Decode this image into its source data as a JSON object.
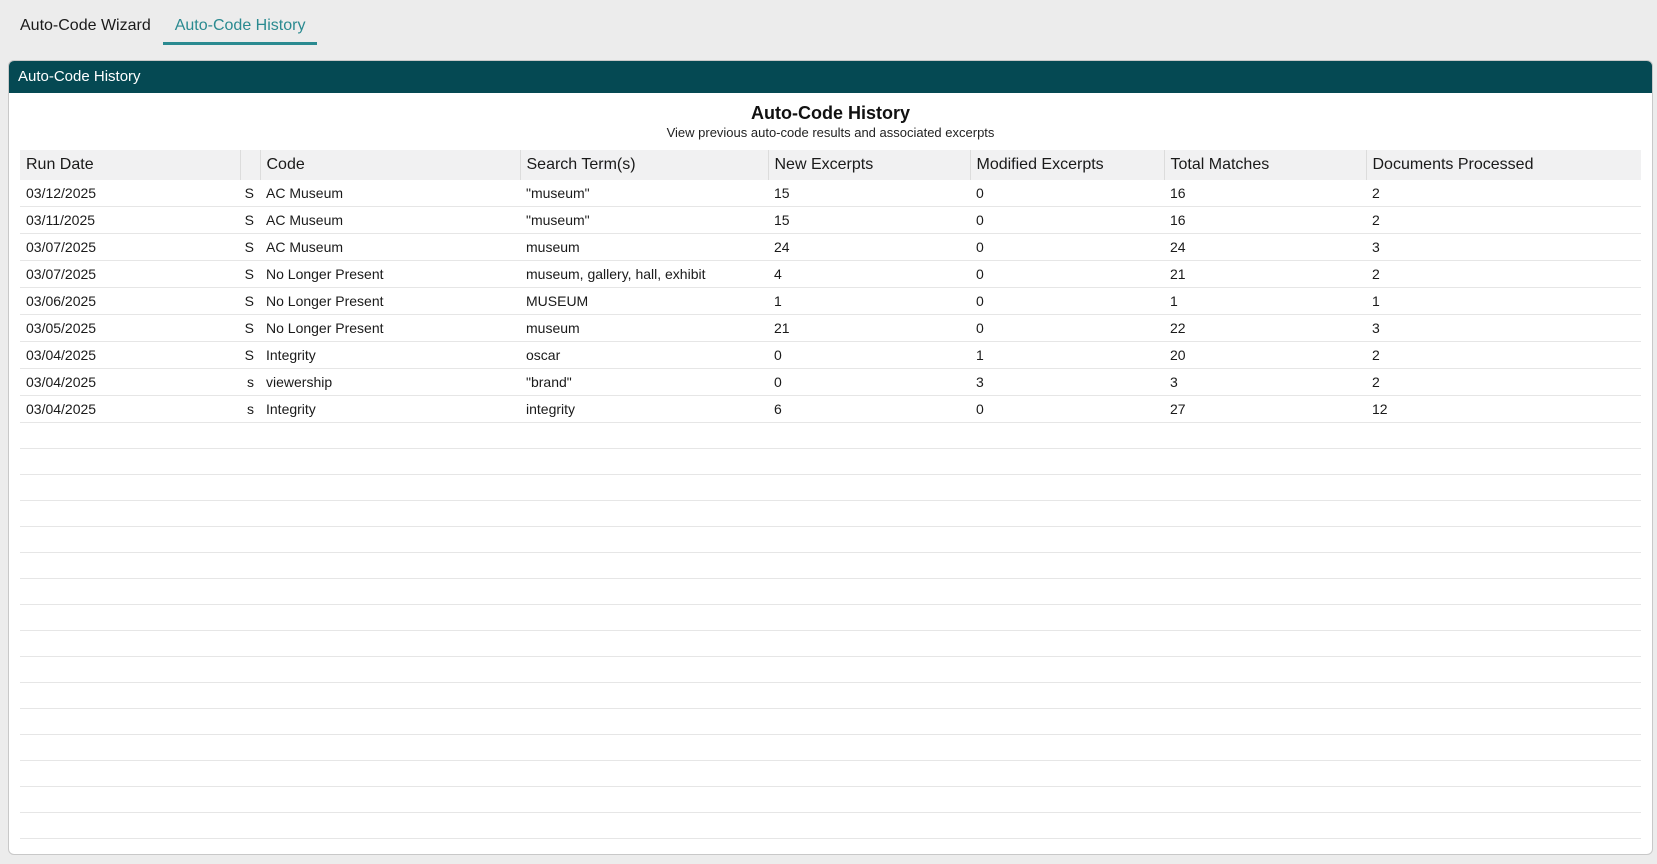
{
  "tabs": [
    {
      "label": "Auto-Code Wizard"
    },
    {
      "label": "Auto-Code History"
    }
  ],
  "panel": {
    "header": "Auto-Code History",
    "title": "Auto-Code History",
    "subtitle": "View previous auto-code results and associated excerpts"
  },
  "table": {
    "columns": [
      "Run Date",
      "",
      "Code",
      "Search Term(s)",
      "New Excerpts",
      "Modified Excerpts",
      "Total Matches",
      "Documents Processed"
    ],
    "rows": [
      {
        "run_date": "03/12/2025",
        "status": "S",
        "code": "AC Museum",
        "search": "\"museum\"",
        "new": "15",
        "modified": "0",
        "total": "16",
        "docs": "2"
      },
      {
        "run_date": "03/11/2025",
        "status": "S",
        "code": "AC Museum",
        "search": "\"museum\"",
        "new": "15",
        "modified": "0",
        "total": "16",
        "docs": "2"
      },
      {
        "run_date": "03/07/2025",
        "status": "S",
        "code": "AC Museum",
        "search": "museum",
        "new": "24",
        "modified": "0",
        "total": "24",
        "docs": "3"
      },
      {
        "run_date": "03/07/2025",
        "status": "S",
        "code": "No Longer Present",
        "search": "museum, gallery, hall, exhibit",
        "new": "4",
        "modified": "0",
        "total": "21",
        "docs": "2"
      },
      {
        "run_date": "03/06/2025",
        "status": "S",
        "code": "No Longer Present",
        "search": "MUSEUM",
        "new": "1",
        "modified": "0",
        "total": "1",
        "docs": "1"
      },
      {
        "run_date": "03/05/2025",
        "status": "S",
        "code": "No Longer Present",
        "search": "museum",
        "new": "21",
        "modified": "0",
        "total": "22",
        "docs": "3"
      },
      {
        "run_date": "03/04/2025",
        "status": "S",
        "code": "Integrity",
        "search": "oscar",
        "new": "0",
        "modified": "1",
        "total": "20",
        "docs": "2"
      },
      {
        "run_date": "03/04/2025",
        "status": "s",
        "code": "viewership",
        "search": "\"brand\"",
        "new": "0",
        "modified": "3",
        "total": "3",
        "docs": "2"
      },
      {
        "run_date": "03/04/2025",
        "status": "s",
        "code": "Integrity",
        "search": "integrity",
        "new": "6",
        "modified": "0",
        "total": "27",
        "docs": "12"
      }
    ]
  }
}
